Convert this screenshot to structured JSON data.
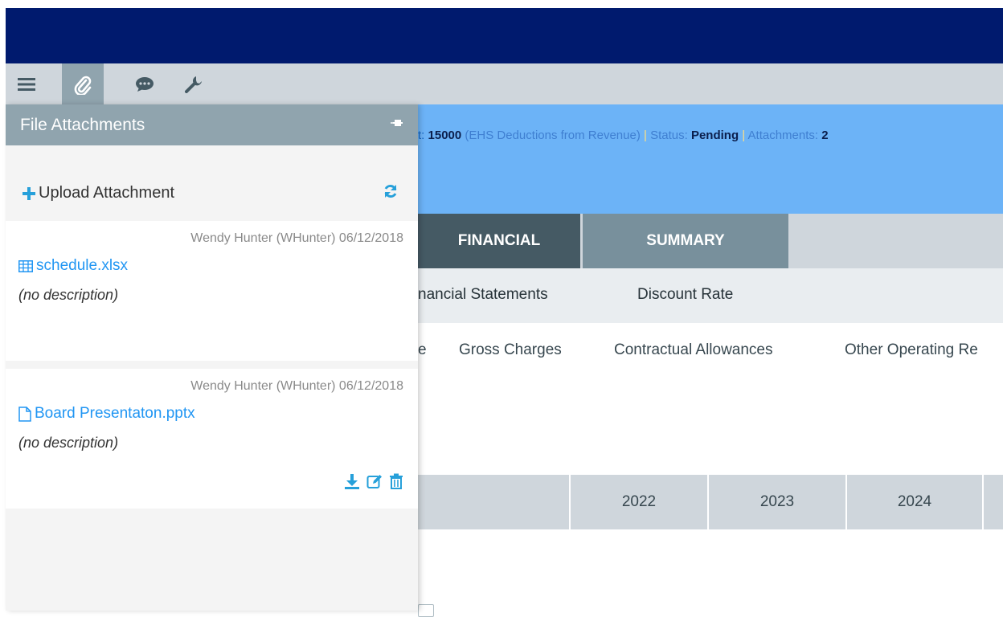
{
  "colors": {
    "topbar": "#001a6e",
    "toolbar": "#cfd6dc",
    "panel_header": "#90a4ae",
    "info_bar": "#6cb3f7",
    "tab_active": "#455a64",
    "tab_inactive": "#78909c",
    "link": "#2196f3"
  },
  "toolbar": {
    "items": [
      {
        "icon": "menu-icon"
      },
      {
        "icon": "paperclip-icon",
        "active": true
      },
      {
        "icon": "chat-icon"
      },
      {
        "icon": "wrench-icon"
      }
    ]
  },
  "info": {
    "prefix": "t: ",
    "account": "15000",
    "account_desc": "(EHS Deductions from Revenue)",
    "sep1": " | ",
    "status_label": "Status: ",
    "status": "Pending",
    "sep2": " | ",
    "attachments_label": "Attachments: ",
    "attachments_count": "2"
  },
  "tabs": [
    {
      "label": "FINANCIAL",
      "active": true
    },
    {
      "label": "SUMMARY",
      "active": false
    }
  ],
  "subtabs": [
    "nancial Statements",
    "Discount Rate"
  ],
  "columns": [
    "e",
    "Gross Charges",
    "Contractual Allowances",
    "Other Operating Re"
  ],
  "years": [
    "2022",
    "2023",
    "2024"
  ],
  "panel": {
    "title": "File Attachments",
    "upload_label": "Upload Attachment",
    "attachments": [
      {
        "meta": "Wendy Hunter (WHunter) 06/12/2018",
        "name": "schedule.xlsx",
        "icon": "spreadsheet-icon",
        "description": "(no description)"
      },
      {
        "meta": "Wendy Hunter (WHunter) 06/12/2018",
        "name": "Board Presentaton.pptx",
        "icon": "document-icon",
        "description": "(no description)"
      }
    ]
  }
}
